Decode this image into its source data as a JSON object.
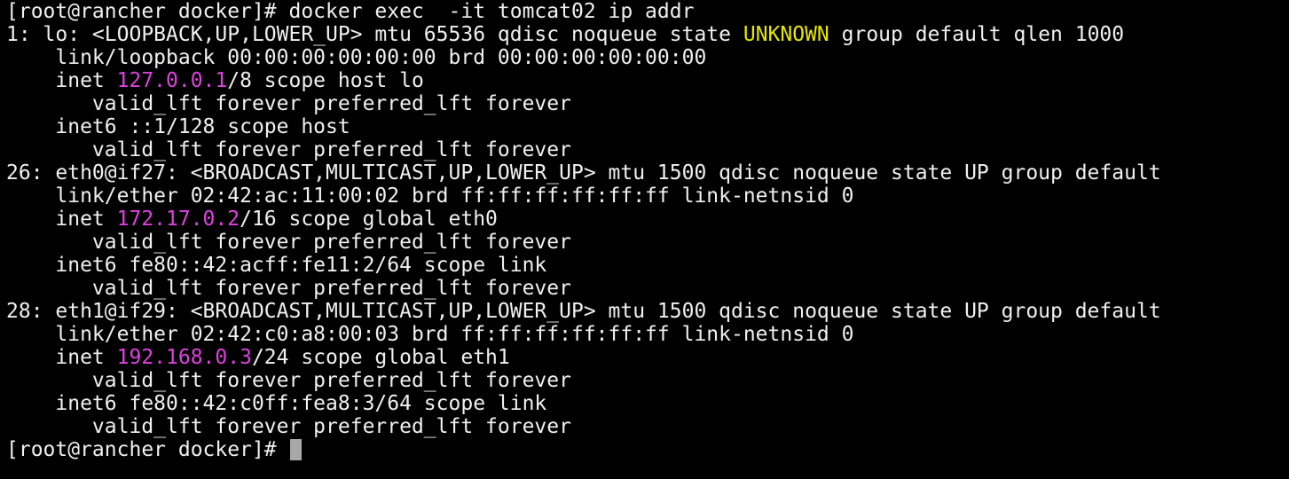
{
  "colors": {
    "background": "#000000",
    "text": "#f0f0f0",
    "highlight_state": "#e6e600",
    "highlight_ip": "#e040e0",
    "cursor": "#a8a8a8"
  },
  "terminal": {
    "lines": [
      [
        {
          "t": "[root@rancher docker]# docker exec  -it tomcat02 ip addr"
        }
      ],
      [
        {
          "t": "1: lo: <LOOPBACK,UP,LOWER_UP> mtu 65536 qdisc noqueue state "
        },
        {
          "t": "UNKNOWN",
          "c": "highlight_state"
        },
        {
          "t": " group default qlen 1000"
        }
      ],
      [
        {
          "t": "    link/loopback 00:00:00:00:00:00 brd 00:00:00:00:00:00"
        }
      ],
      [
        {
          "t": "    inet "
        },
        {
          "t": "127.0.0.1",
          "c": "highlight_ip"
        },
        {
          "t": "/8 scope host lo"
        }
      ],
      [
        {
          "t": "       valid_lft forever preferred_lft forever"
        }
      ],
      [
        {
          "t": "    inet6 ::1/128 scope host"
        }
      ],
      [
        {
          "t": "       valid_lft forever preferred_lft forever"
        }
      ],
      [
        {
          "t": "26: eth0@if27: <BROADCAST,MULTICAST,UP,LOWER_UP> mtu 1500 qdisc noqueue state UP group default"
        }
      ],
      [
        {
          "t": "    link/ether 02:42:ac:11:00:02 brd ff:ff:ff:ff:ff:ff link-netnsid 0"
        }
      ],
      [
        {
          "t": "    inet "
        },
        {
          "t": "172.17.0.2",
          "c": "highlight_ip"
        },
        {
          "t": "/16 scope global eth0"
        }
      ],
      [
        {
          "t": "       valid_lft forever preferred_lft forever"
        }
      ],
      [
        {
          "t": "    inet6 fe80::42:acff:fe11:2/64 scope link"
        }
      ],
      [
        {
          "t": "       valid_lft forever preferred_lft forever"
        }
      ],
      [
        {
          "t": "28: eth1@if29: <BROADCAST,MULTICAST,UP,LOWER_UP> mtu 1500 qdisc noqueue state UP group default"
        }
      ],
      [
        {
          "t": "    link/ether 02:42:c0:a8:00:03 brd ff:ff:ff:ff:ff:ff link-netnsid 0"
        }
      ],
      [
        {
          "t": "    inet "
        },
        {
          "t": "192.168.0.3",
          "c": "highlight_ip"
        },
        {
          "t": "/24 scope global eth1"
        }
      ],
      [
        {
          "t": "       valid_lft forever preferred_lft forever"
        }
      ],
      [
        {
          "t": "    inet6 fe80::42:c0ff:fea8:3/64 scope link"
        }
      ],
      [
        {
          "t": "       valid_lft forever preferred_lft forever"
        }
      ],
      [
        {
          "t": "[root@rancher docker]# "
        }
      ]
    ],
    "prompt_line_has_cursor": true
  }
}
